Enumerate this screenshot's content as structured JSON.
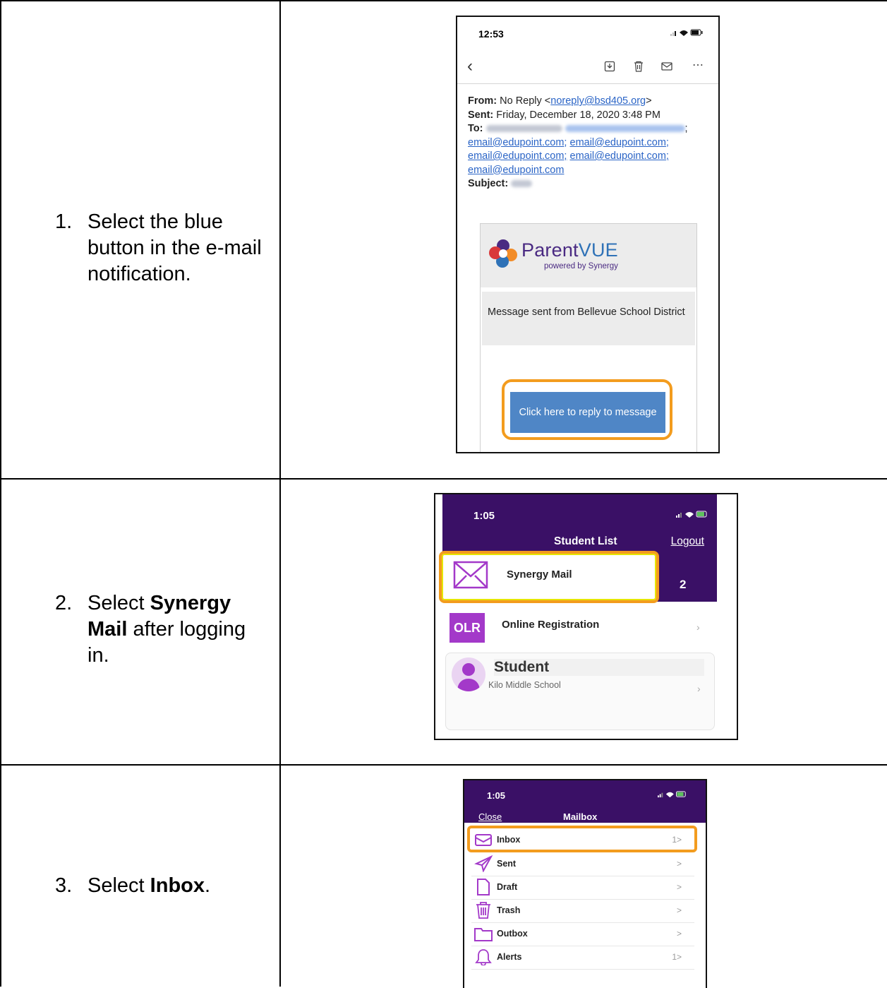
{
  "steps": [
    {
      "num": "1.",
      "text": "Select the blue button in the e-mail notification."
    },
    {
      "num": "2.",
      "pre": "Select ",
      "bold": "Synergy Mail",
      "post": " after logging in."
    },
    {
      "num": "3.",
      "pre": "Select ",
      "bold": "Inbox",
      "post": "."
    }
  ],
  "email": {
    "time": "12:53",
    "from_label": "From:",
    "from_name": "No Reply <",
    "from_email": "noreply@bsd405.org",
    "from_end": ">",
    "sent_label": "Sent:",
    "sent_value": "Friday, December 18, 2020 3:48 PM",
    "to_label": "To:",
    "to_emails": [
      "email@edupoint.com;",
      "email@edupoint.com;",
      "email@edupoint.com;",
      "email@edupoint.com;",
      "email@edupoint.com"
    ],
    "subject_label": "Subject:",
    "brand_parent": "Parent",
    "brand_vue": "VUE",
    "brand_sub": "powered by Synergy",
    "message": "Message sent from Bellevue School District",
    "button": "Click here to reply to message"
  },
  "studentList": {
    "time": "1:05",
    "title": "Student List",
    "logout": "Logout",
    "synergy_mail": "Synergy Mail",
    "count": "2",
    "olr_badge": "OLR",
    "online_registration": "Online Registration",
    "student_name": "Student",
    "school": "Kilo Middle School"
  },
  "mailbox": {
    "time": "1:05",
    "close": "Close",
    "title": "Mailbox",
    "folders": [
      {
        "label": "Inbox",
        "count": "1>",
        "icon": "inbox-icon"
      },
      {
        "label": "Sent",
        "count": ">",
        "icon": "send-icon"
      },
      {
        "label": "Draft",
        "count": ">",
        "icon": "document-icon"
      },
      {
        "label": "Trash",
        "count": ">",
        "icon": "trash-icon"
      },
      {
        "label": "Outbox",
        "count": ">",
        "icon": "folder-icon"
      },
      {
        "label": "Alerts",
        "count": "1>",
        "icon": "bell-icon"
      }
    ]
  },
  "colors": {
    "purple": "#3a1066",
    "highlight": "#f39c1e",
    "button": "#4f86c6",
    "link": "#2a64c6"
  }
}
